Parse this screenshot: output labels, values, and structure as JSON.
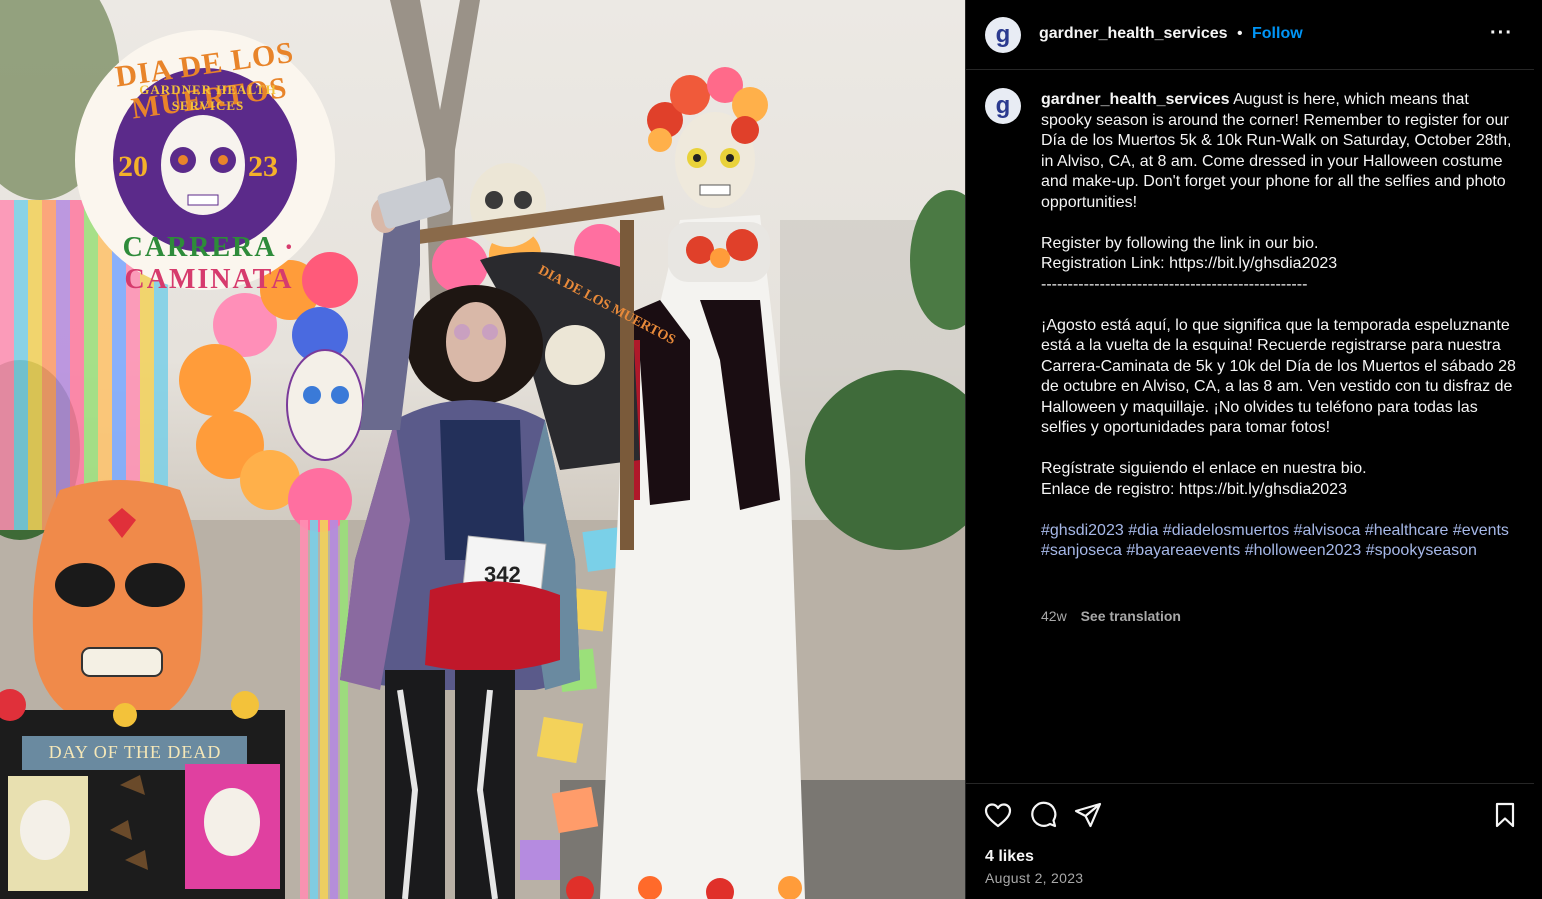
{
  "photo": {
    "logo_title": "DIA DE LOS MUERTOS",
    "logo_org": "GARDNER HEALTH SERVICES",
    "logo_year_left": "20",
    "logo_year_right": "23",
    "logo_sub_left": "CARRERA",
    "logo_sub_sep": "·",
    "logo_sub_right": "CAMINATA",
    "sign_text": "DAY OF THE DEAD",
    "bib_number": "342",
    "shirt_text": "DIA DE LOS MUERTOS"
  },
  "header": {
    "avatar_letter": "g",
    "username": "gardner_health_services",
    "separator": "•",
    "follow_label": "Follow",
    "more_label": "···"
  },
  "caption": {
    "avatar_letter": "g",
    "username": "gardner_health_services",
    "para1": "August is here, which means that spooky season is around the corner! Remember to register for our Día de los Muertos 5k & 10k Run-Walk on Saturday, October 28th, in Alviso, CA, at 8 am. Come dressed in your Halloween costume and make-up. Don't forget your phone for all the selfies and photo opportunities!",
    "para2_line1": "Register by following the link in our bio.",
    "para2_line2": "Registration Link: https://bit.ly/ghsdia2023",
    "divider": "--------------------------------------------------",
    "para3": "¡Agosto está aquí, lo que significa que la temporada espeluznante está a la vuelta de la esquina! Recuerde registrarse para nuestra Carrera-Caminata de 5k y 10k del Día de los Muertos el sábado 28 de octubre en Alviso, CA, a las 8 am. Ven vestido con tu disfraz de Halloween y maquillaje. ¡No olvides tu teléfono para todas las selfies y oportunidades para tomar fotos!",
    "para4_line1": "Regístrate siguiendo el enlace en nuestra bio.",
    "para4_line2": "Enlace de registro: https://bit.ly/ghsdia2023",
    "hashtags": [
      "#ghsdi2023",
      "#dia",
      "#diadelosmuertos",
      "#alvisoca",
      "#healthcare",
      "#events",
      "#sanjoseca",
      "#bayareaevents",
      "#holloween2023",
      "#spookyseason"
    ],
    "age": "42w",
    "see_translation": "See translation"
  },
  "actions": {
    "like_icon": "heart-icon",
    "comment_icon": "comment-icon",
    "share_icon": "share-icon",
    "save_icon": "bookmark-icon",
    "likes_text": "4 likes",
    "date_text": "August 2, 2023"
  },
  "colors": {
    "link_blue": "#0095f6",
    "hashtag": "#a6b8e8",
    "muted": "#a8a8a8",
    "background": "#000000"
  }
}
